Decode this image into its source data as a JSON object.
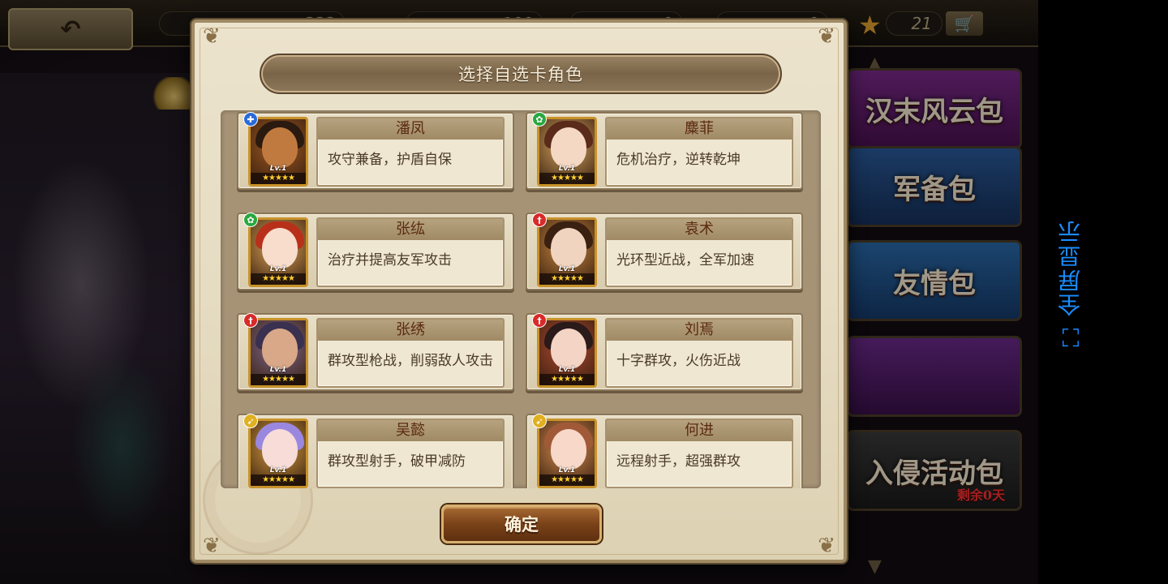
{
  "background": {
    "resources": [
      {
        "name": "gem",
        "value": "333"
      },
      {
        "name": "jade",
        "value": "100"
      },
      {
        "name": "card",
        "value": "0"
      },
      {
        "name": "token",
        "value": "0"
      },
      {
        "name": "star",
        "value": "21"
      }
    ],
    "packs": [
      {
        "label": "汉末风云包",
        "color_from": "#7a2a8a",
        "color_to": "#4a1050"
      },
      {
        "label": "军备包",
        "color_from": "#2a5a9a",
        "color_to": "#16305a"
      },
      {
        "label": "友情包",
        "color_from": "#2a6aaa",
        "color_to": "#163a6a"
      },
      {
        "label": "",
        "color_from": "#6a2a8a",
        "color_to": "#3a104a"
      },
      {
        "label": "入侵活动包",
        "color_from": "#3a3a3a",
        "color_to": "#1a1a1a",
        "sub": "剩余0天"
      }
    ]
  },
  "fullscreen": {
    "label": "全屏显示",
    "icon": "expand-icon"
  },
  "dialog": {
    "title": "选择自选卡角色",
    "confirm_label": "确定",
    "characters": [
      {
        "name": "潘凤",
        "desc": "攻守兼备，护盾自保",
        "level": "Lv.1",
        "stars": "★★★★★",
        "badge_color": "#2a6ad8",
        "badge_icon": "shield-class-icon",
        "skin": "#c07a40",
        "hair": "#2a1a10",
        "bg": "#a05a20"
      },
      {
        "name": "麋菲",
        "desc": "危机治疗，逆转乾坤",
        "level": "Lv.1",
        "stars": "★★★★★",
        "badge_color": "#2aa840",
        "badge_icon": "healer-class-icon",
        "skin": "#f4d8c4",
        "hair": "#5a2a1a",
        "bg": "#d8a860"
      },
      {
        "name": "张纮",
        "desc": "治疗并提高友军攻击",
        "level": "Lv.1",
        "stars": "★★★★★",
        "badge_color": "#2aa840",
        "badge_icon": "healer-class-icon",
        "skin": "#f8dccc",
        "hair": "#b8301a",
        "bg": "#e0a858"
      },
      {
        "name": "袁术",
        "desc": "光环型近战，全军加速",
        "level": "Lv.1",
        "stars": "★★★★★",
        "badge_color": "#d82a2a",
        "badge_icon": "warrior-class-icon",
        "skin": "#f0d4c0",
        "hair": "#3a2010",
        "bg": "#c88840"
      },
      {
        "name": "张绣",
        "desc": "群攻型枪战，削弱敌人攻击",
        "level": "Lv.1",
        "stars": "★★★★★",
        "badge_color": "#d82a2a",
        "badge_icon": "warrior-class-icon",
        "skin": "#d8a888",
        "hair": "#3a3050",
        "bg": "#806a90"
      },
      {
        "name": "刘焉",
        "desc": "十字群攻，火伤近战",
        "level": "Lv.1",
        "stars": "★★★★★",
        "badge_color": "#d82a2a",
        "badge_icon": "warrior-class-icon",
        "skin": "#f4d4c4",
        "hair": "#2a1a1a",
        "bg": "#b04a30"
      },
      {
        "name": "吴懿",
        "desc": "群攻型射手，破甲减防",
        "level": "Lv.1",
        "stars": "★★★★★",
        "badge_color": "#e0b020",
        "badge_icon": "archer-class-icon",
        "skin": "#f8dcd8",
        "hair": "#9a88e0",
        "bg": "#d8a040"
      },
      {
        "name": "何进",
        "desc": "远程射手，超强群攻",
        "level": "Lv.1",
        "stars": "★★★★★",
        "badge_color": "#e0b020",
        "badge_icon": "archer-class-icon",
        "skin": "#f8d8c8",
        "hair": "#a05a38",
        "bg": "#d89050"
      }
    ]
  }
}
